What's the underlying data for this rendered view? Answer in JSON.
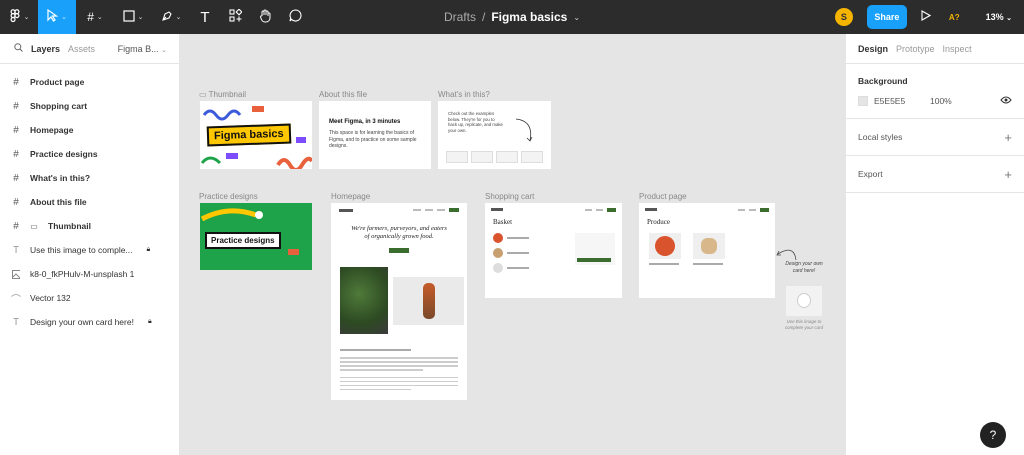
{
  "toolbar": {
    "tools": [
      "figma-menu",
      "move",
      "frame",
      "shape",
      "pen",
      "text",
      "components",
      "hand",
      "comment"
    ],
    "breadcrumb_parent": "Drafts",
    "breadcrumb_sep": "/",
    "file_name": "Figma basics",
    "avatar_initial": "S",
    "share_label": "Share",
    "access_label": "A?",
    "zoom_label": "13%"
  },
  "left_panel": {
    "tab_layers": "Layers",
    "tab_assets": "Assets",
    "page_name": "Figma B...",
    "layers": [
      {
        "icon": "frame-icon",
        "label": "Product page",
        "locked": false,
        "bold": true
      },
      {
        "icon": "frame-icon",
        "label": "Shopping cart",
        "locked": false,
        "bold": true
      },
      {
        "icon": "frame-icon",
        "label": "Homepage",
        "locked": false,
        "bold": true
      },
      {
        "icon": "frame-icon",
        "label": "Practice designs",
        "locked": false,
        "bold": true
      },
      {
        "icon": "frame-icon",
        "label": "What's in this?",
        "locked": false,
        "bold": true
      },
      {
        "icon": "frame-icon",
        "label": "About this file",
        "locked": false,
        "bold": true
      },
      {
        "icon": "frame-icon",
        "label": "Thumbnail",
        "locked": false,
        "bold": true
      },
      {
        "icon": "text-icon",
        "label": "Use this image to comple...",
        "locked": true,
        "bold": false
      },
      {
        "icon": "image-icon",
        "label": "k8-0_fkPHulv-M-unsplash 1",
        "locked": false,
        "bold": false
      },
      {
        "icon": "vector-icon",
        "label": "Vector 132",
        "locked": false,
        "bold": false
      },
      {
        "icon": "text-icon",
        "label": "Design your own card here!",
        "locked": true,
        "bold": false
      }
    ]
  },
  "right_panel": {
    "tab_design": "Design",
    "tab_prototype": "Prototype",
    "tab_inspect": "Inspect",
    "background_title": "Background",
    "background_hex": "E5E5E5",
    "background_opacity": "100%",
    "local_styles": "Local styles",
    "export": "Export"
  },
  "canvas": {
    "labels": {
      "thumbnail": "Thumbnail",
      "about": "About this file",
      "whats_in": "What's in this?",
      "practice": "Practice designs",
      "homepage": "Homepage",
      "cart": "Shopping cart",
      "product": "Product page"
    },
    "thumbnail_title": "Figma basics",
    "about_title": "Meet Figma, in 3 minutes",
    "about_body": "This space is for learning the basics of Figma, and to practice on some sample designs.",
    "whats_in_body": "Check out the examples below. They're for you to hack up, replicate, and make your own.",
    "practice_title": "Practice designs",
    "homepage_heading": "We're farmers, purveyors, and eaters of organically grown food.",
    "cart_heading": "Basket",
    "product_heading": "Produce",
    "design_card_note": "Design your own card here!",
    "use_image_note": "Use this image to complete your card"
  },
  "colors": {
    "toolbar_bg": "#2c2c2c",
    "accent_blue": "#18a0fb",
    "avatar_yellow": "#f5b400",
    "canvas_bg": "#e5e5e5",
    "practice_green": "#1fa34a",
    "figma_yellow": "#ffc700",
    "brand_green": "#3b6d2e"
  },
  "help_label": "?"
}
